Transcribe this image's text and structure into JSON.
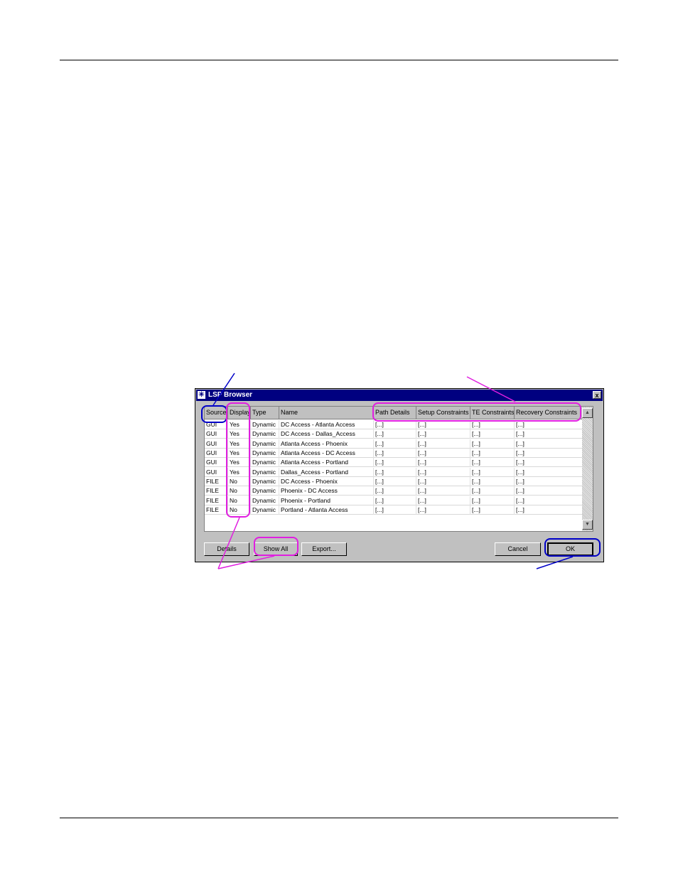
{
  "dialog": {
    "title": "LSP Browser",
    "close_glyph": "x",
    "app_icon": "star-icon"
  },
  "table": {
    "columns": [
      "Source",
      "Display",
      "Type",
      "Name",
      "Path Details",
      "Setup Constraints",
      "TE Constraints",
      "Recovery Constraints"
    ],
    "rows": [
      [
        "GUI",
        "Yes",
        "Dynamic",
        "DC Access - Atlanta Access",
        "[...]",
        "[...]",
        "[...]",
        "[...]"
      ],
      [
        "GUI",
        "Yes",
        "Dynamic",
        "DC Access - Dallas_Access",
        "[...]",
        "[...]",
        "[...]",
        "[...]"
      ],
      [
        "GUI",
        "Yes",
        "Dynamic",
        "Atlanta Access - Phoenix",
        "[...]",
        "[...]",
        "[...]",
        "[...]"
      ],
      [
        "GUI",
        "Yes",
        "Dynamic",
        "Atlanta Access - DC Access",
        "[...]",
        "[...]",
        "[...]",
        "[...]"
      ],
      [
        "GUI",
        "Yes",
        "Dynamic",
        "Atlanta Access - Portland",
        "[...]",
        "[...]",
        "[...]",
        "[...]"
      ],
      [
        "GUI",
        "Yes",
        "Dynamic",
        "Dallas_Access - Portland",
        "[...]",
        "[...]",
        "[...]",
        "[...]"
      ],
      [
        "FILE",
        "No",
        "Dynamic",
        "DC Access - Phoenix",
        "[...]",
        "[...]",
        "[...]",
        "[...]"
      ],
      [
        "FILE",
        "No",
        "Dynamic",
        "Phoenix - DC Access",
        "[...]",
        "[...]",
        "[...]",
        "[...]"
      ],
      [
        "FILE",
        "No",
        "Dynamic",
        "Phoenix - Portland",
        "[...]",
        "[...]",
        "[...]",
        "[...]"
      ],
      [
        "FILE",
        "No",
        "Dynamic",
        "Portland - Atlanta Access",
        "[...]",
        "[...]",
        "[...]",
        "[...]"
      ]
    ]
  },
  "buttons": {
    "details": "Details",
    "show_all": "Show All",
    "export": "Export...",
    "cancel": "Cancel",
    "ok": "OK"
  },
  "colors": {
    "title_bar": "#000080",
    "callout_blue": "#0000c8",
    "callout_magenta": "#e01ee0"
  }
}
